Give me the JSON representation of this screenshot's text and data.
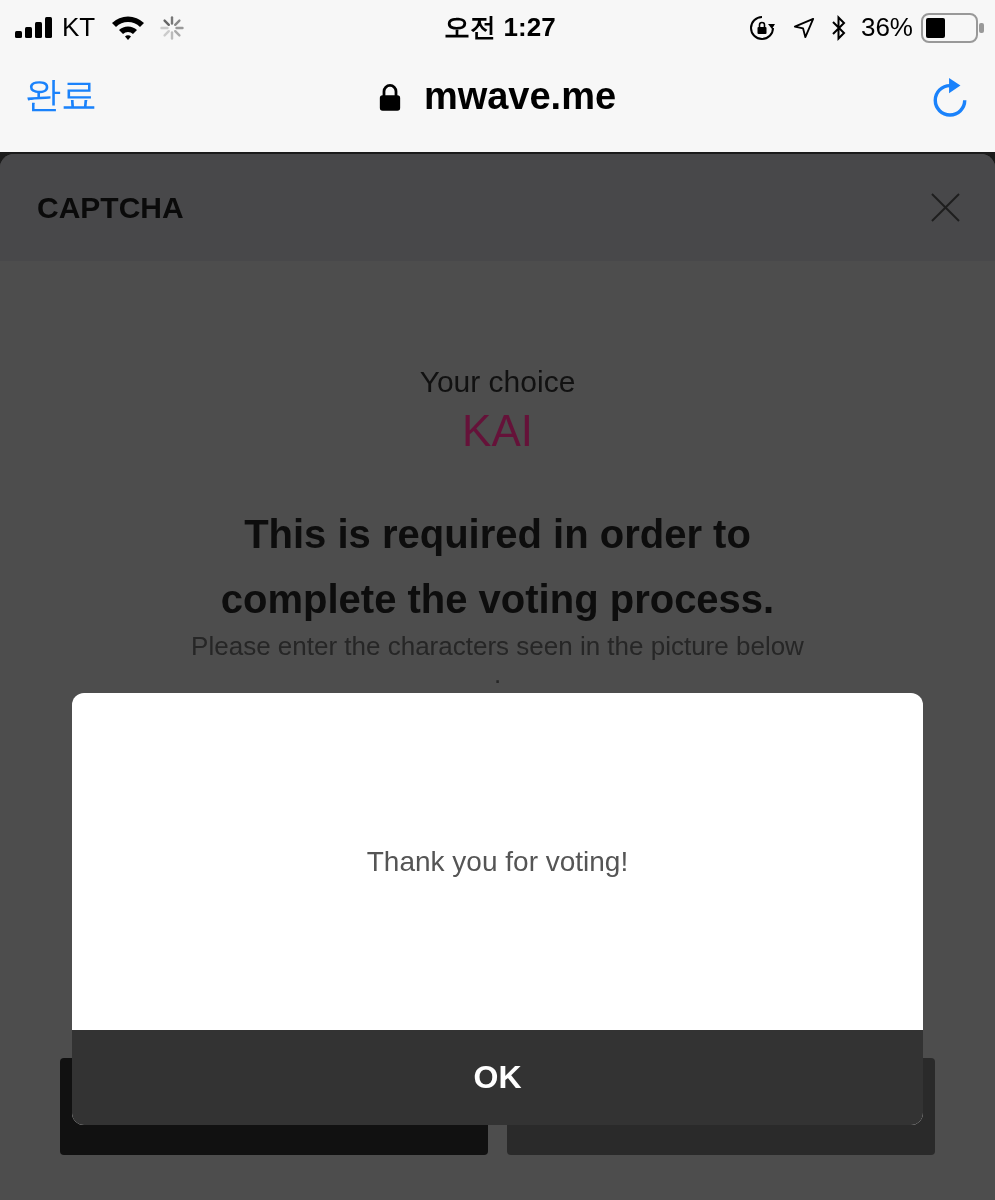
{
  "status_bar": {
    "carrier": "KT",
    "time": "오전 1:27",
    "battery": "36%"
  },
  "nav_bar": {
    "done_button": "완료",
    "url": "mwave.me"
  },
  "modal": {
    "title": "CAPTCHA",
    "choice_label": "Your choice",
    "choice": "KAI",
    "heading": "This is required in order to complete the voting process.",
    "instruction_lines": [
      "Please enter the characters seen in the picture below",
      "."
    ]
  },
  "alert": {
    "message": "Thank you for voting!",
    "button": "OK"
  }
}
